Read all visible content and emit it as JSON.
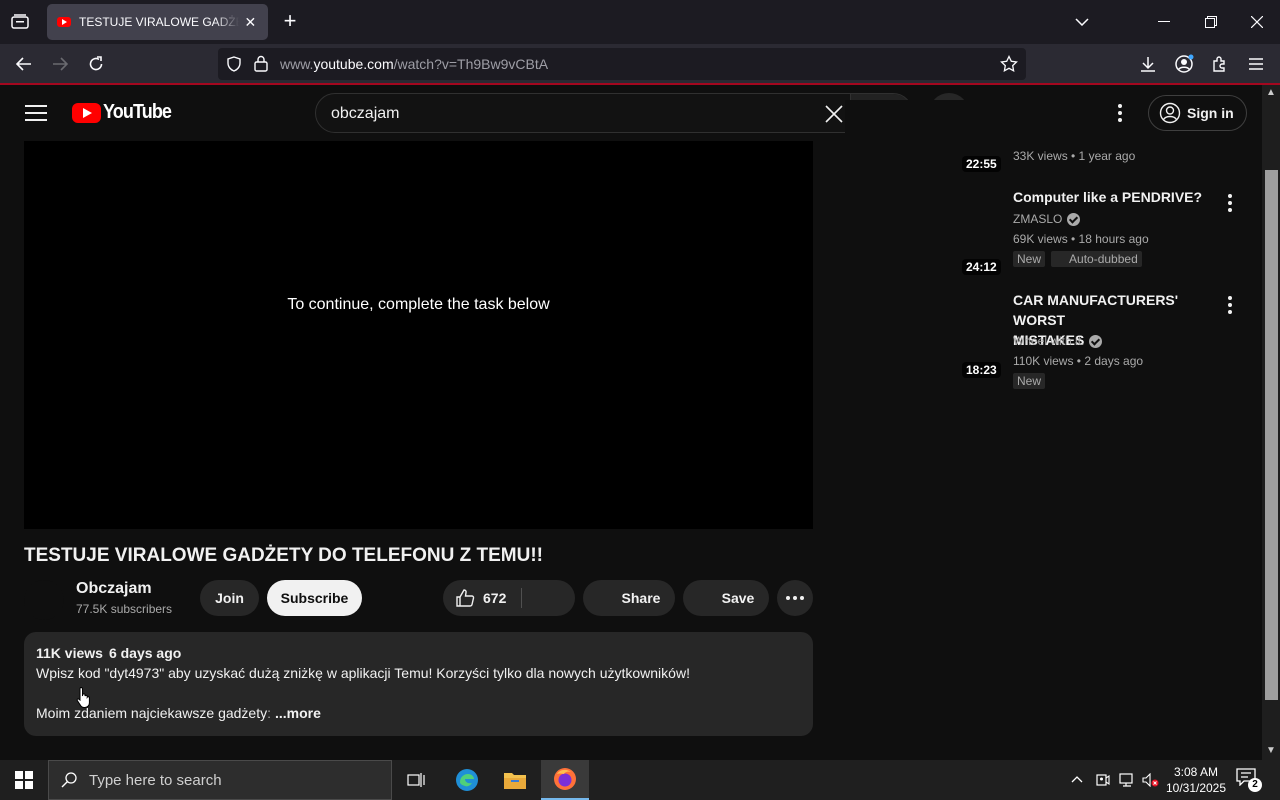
{
  "browser": {
    "tab_title": "TESTUJE VIRALOWE GADŻETY DO TELEFONU Z TEMU!! - YouTube",
    "url_prefix": "www.",
    "url_domain": "youtube.com",
    "url_path": "/watch?v=Th9Bw9vCBtA"
  },
  "header": {
    "logo_text": "YouTube",
    "search_value": "obczajam",
    "signin_label": "Sign in"
  },
  "player": {
    "message": "To continue, complete the task below"
  },
  "video": {
    "title": "TESTUJE VIRALOWE GADŻETY DO TELEFONU Z TEMU!!",
    "channel": "Obczajam",
    "subscribers": "77.5K subscribers",
    "join_label": "Join",
    "subscribe_label": "Subscribe",
    "likes": "672",
    "share_label": "Share",
    "save_label": "Save"
  },
  "description": {
    "views": "11K views",
    "age": "6 days ago",
    "line1": "Wpisz kod \"dyt4973\" aby uzyskać dużą zniżkę w aplikacji Temu! Korzyści tylko dla nowych użytkowników!",
    "line2": "Moim zdaniem najciekawsze gadżety",
    "line2_fade": ":",
    "more_label": "...more"
  },
  "recommendations": [
    {
      "duration": "22:55",
      "meta": "33K views • 1 year ago"
    },
    {
      "duration": "24:12",
      "title": "Computer like a PENDRIVE?",
      "channel": "ZMASLO",
      "meta": "69K views • 18 hours ago",
      "badges": [
        "New",
        "Auto-dubbed"
      ]
    },
    {
      "duration": "18:23",
      "title_line1": "CAR MANUFACTURERS' WORST",
      "title_line2": "MISTAKES",
      "channel": "Wheel with it.",
      "meta": "110K views • 2 days ago",
      "badges": [
        "New"
      ]
    }
  ],
  "taskbar": {
    "search_placeholder": "Type here to search",
    "time": "3:08 AM",
    "date": "10/31/2025",
    "notification_count": "2"
  }
}
